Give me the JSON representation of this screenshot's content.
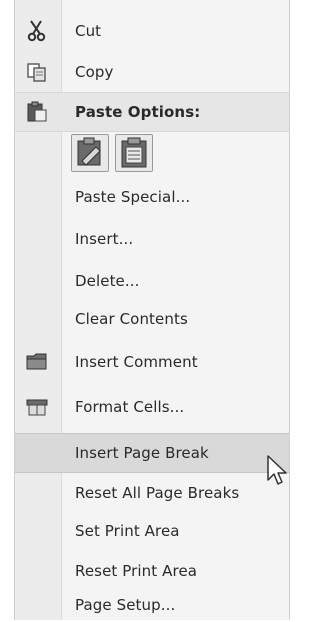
{
  "menu": {
    "items": [
      {
        "label": "Cut",
        "icon": "scissors-icon",
        "type": "action"
      },
      {
        "label": "Copy",
        "icon": "copy-icon",
        "type": "action"
      },
      {
        "label": "Paste Options:",
        "icon": "paste-icon",
        "type": "header"
      },
      {
        "label": "Paste Special...",
        "icon": "",
        "type": "action"
      },
      {
        "label": "Insert...",
        "icon": "",
        "type": "action"
      },
      {
        "label": "Delete...",
        "icon": "",
        "type": "action"
      },
      {
        "label": "Clear Contents",
        "icon": "",
        "type": "action"
      },
      {
        "label": "Insert Comment",
        "icon": "comment-icon",
        "type": "action"
      },
      {
        "label": "Format Cells...",
        "icon": "format-cells-icon",
        "type": "action"
      },
      {
        "label": "Insert Page Break",
        "icon": "",
        "type": "action",
        "highlighted": true
      },
      {
        "label": "Reset All Page Breaks",
        "icon": "",
        "type": "action"
      },
      {
        "label": "Set Print Area",
        "icon": "",
        "type": "action"
      },
      {
        "label": "Reset Print Area",
        "icon": "",
        "type": "action"
      },
      {
        "label": "Page Setup...",
        "icon": "",
        "type": "action"
      }
    ],
    "paste_options": [
      {
        "icon": "paste-formatting-icon"
      },
      {
        "icon": "paste-values-icon"
      }
    ]
  },
  "colors": {
    "menu_background": "#f4f4f4",
    "gutter": "#ececec",
    "highlight": "#d9d9d9",
    "text": "#2a2a2a"
  }
}
